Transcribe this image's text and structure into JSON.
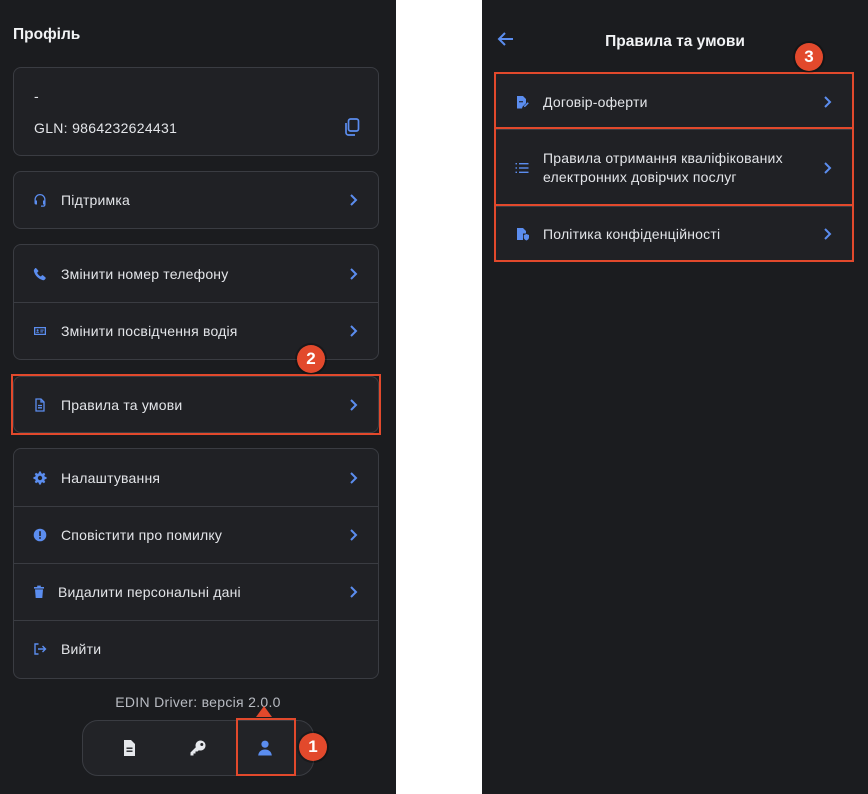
{
  "left": {
    "title": "Профіль",
    "profile": {
      "name": "-",
      "gln": "GLN: 9864232624431",
      "copy_icon": "copy-icon"
    },
    "support": {
      "label": "Підтримка",
      "icon": "headset-icon"
    },
    "account_items": [
      {
        "label": "Змінити номер телефону",
        "icon": "phone-icon"
      },
      {
        "label": "Змінити посвідчення водія",
        "icon": "id-card-icon"
      }
    ],
    "terms": {
      "label": "Правила та умови",
      "icon": "document-icon"
    },
    "settings_items": [
      {
        "label": "Налаштування",
        "icon": "gear-icon"
      },
      {
        "label": "Сповістити про помилку",
        "icon": "alert-icon"
      },
      {
        "label": "Видалити персональні дані",
        "icon": "trash-icon"
      },
      {
        "label": "Вийти",
        "icon": "logout-icon"
      }
    ],
    "version": "EDIN Driver: версія 2.0.0",
    "nav": [
      "document-icon",
      "key-icon",
      "user-icon"
    ]
  },
  "right": {
    "title": "Правила та умови",
    "items": [
      {
        "label": "Договір-оферти",
        "icon": "signed-document-icon"
      },
      {
        "label": "Правила отримання кваліфікованих електронних довірчих послуг",
        "icon": "numbered-list-icon"
      },
      {
        "label": "Політика конфіденційності",
        "icon": "privacy-document-icon"
      }
    ]
  },
  "annotations": {
    "badge_1": "1",
    "badge_2": "2",
    "badge_3": "3"
  },
  "colors": {
    "accent": "#5b8def",
    "highlight": "#e2492c",
    "background": "#1b1c1f",
    "card": "#202125"
  }
}
